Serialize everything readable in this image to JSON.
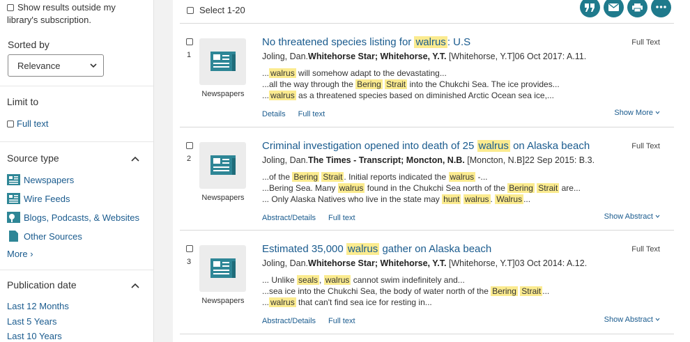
{
  "sidebar": {
    "outside_line1": "Show results outside my",
    "outside_line2": "library's subscription.",
    "sorted_by_label": "Sorted by",
    "sort_value": "Relevance",
    "limit_to_label": "Limit to",
    "full_text_option": "Full text",
    "source_type_label": "Source type",
    "source_types": [
      {
        "label": "Newspapers",
        "icon": "newspaper-icon"
      },
      {
        "label": "Wire Feeds",
        "icon": "newspaper-icon"
      },
      {
        "label": "Blogs, Podcasts, & Websites",
        "icon": "blog-icon"
      },
      {
        "label": "Other Sources",
        "icon": "document-icon"
      }
    ],
    "more_label": "More ›",
    "publication_date_label": "Publication date",
    "date_options": [
      "Last 12 Months",
      "Last 5 Years",
      "Last 10 Years"
    ]
  },
  "toolbar": {
    "select_label": "Select 1-20",
    "actions": [
      "cite-icon",
      "email-icon",
      "print-icon",
      "more-icon"
    ]
  },
  "results": [
    {
      "number": "1",
      "type": "Newspapers",
      "title_pre": "No threatened species listing for ",
      "title_hl": "walrus",
      "title_post": ": U.S",
      "availability": "Full Text",
      "author": "Joling, Dan.",
      "publication": "Whitehorse Star; Whitehorse, Y.T.",
      "citation": " [Whitehorse, Y.T]06 Oct 2017: A.11.",
      "snippets": [
        [
          {
            "t": "..."
          },
          {
            "h": "walrus"
          },
          {
            "t": " will somehow adapt to the devastating..."
          }
        ],
        [
          {
            "t": "...all the way through the "
          },
          {
            "h": "Bering"
          },
          {
            "t": " "
          },
          {
            "h": "Strait"
          },
          {
            "t": " into the Chukchi Sea. The ice provides..."
          }
        ],
        [
          {
            "t": "..."
          },
          {
            "h": "walrus"
          },
          {
            "t": " as a threatened species based on diminished Arctic Ocean sea ice,..."
          }
        ]
      ],
      "link1": "Details",
      "link2": "Full text",
      "show_label": "Show More"
    },
    {
      "number": "2",
      "type": "Newspapers",
      "title_pre": "Criminal investigation opened into death of 25 ",
      "title_hl": "walrus",
      "title_post": " on Alaska beach",
      "availability": "Full Text",
      "author": "Joling, Dan.",
      "publication": "The Times - Transcript; Moncton, N.B.",
      "citation": " [Moncton, N.B]22 Sep 2015: B.3.",
      "snippets": [
        [
          {
            "t": "...of the "
          },
          {
            "h": "Bering"
          },
          {
            "t": " "
          },
          {
            "h": "Strait"
          },
          {
            "t": ". Initial reports indicated the "
          },
          {
            "h": "walrus"
          },
          {
            "t": " -..."
          }
        ],
        [
          {
            "t": "...Bering Sea. Many "
          },
          {
            "h": "walrus"
          },
          {
            "t": " found in the Chukchi Sea north of the "
          },
          {
            "h": "Bering"
          },
          {
            "t": " "
          },
          {
            "h": "Strait"
          },
          {
            "t": " are..."
          }
        ],
        [
          {
            "t": "... Only Alaska Natives who live in the state may "
          },
          {
            "h": "hunt"
          },
          {
            "t": " "
          },
          {
            "h": "walrus"
          },
          {
            "t": ". "
          },
          {
            "h": "Walrus"
          },
          {
            "t": "..."
          }
        ]
      ],
      "link1": "Abstract/Details",
      "link2": "Full text",
      "show_label": "Show Abstract"
    },
    {
      "number": "3",
      "type": "Newspapers",
      "title_pre": "Estimated 35,000 ",
      "title_hl": "walrus",
      "title_post": " gather on Alaska beach",
      "availability": "Full Text",
      "author": "Joling, Dan.",
      "publication": "Whitehorse Star; Whitehorse, Y.T.",
      "citation": " [Whitehorse, Y.T]03 Oct 2014: A.12.",
      "snippets": [
        [
          {
            "t": "... Unlike "
          },
          {
            "h": "seals"
          },
          {
            "t": ", "
          },
          {
            "h": "walrus"
          },
          {
            "t": " cannot swim indefinitely and..."
          }
        ],
        [
          {
            "t": "...sea ice into the Chukchi Sea, the body of water north of the "
          },
          {
            "h": "Bering"
          },
          {
            "t": " "
          },
          {
            "h": "Strait"
          },
          {
            "t": "..."
          }
        ],
        [
          {
            "t": "..."
          },
          {
            "h": "walrus"
          },
          {
            "t": " that can't find sea ice for resting in..."
          }
        ]
      ],
      "link1": "Abstract/Details",
      "link2": "Full text",
      "show_label": "Show Abstract"
    }
  ],
  "colors": {
    "link": "#1a5b8e",
    "highlight": "#fbeb8f",
    "action_button": "#1f7a8c",
    "thumb_icon": "#2e8696"
  }
}
